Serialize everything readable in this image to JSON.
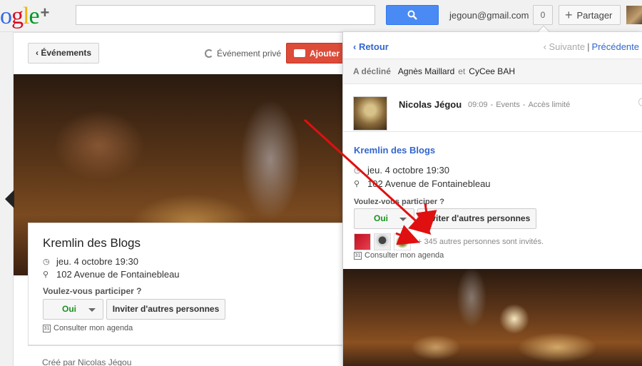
{
  "topbar": {
    "logo_parts": [
      "o",
      "g",
      "l",
      "e"
    ],
    "logo_plus": "+",
    "user_email": "jegoun@gmail.com",
    "notifications_count": "0",
    "share_label": "Partager"
  },
  "left": {
    "back_label": "Événements",
    "private_label": "Événement privé",
    "add_photo_label": "Ajouter",
    "title": "Kremlin des Blogs",
    "date": "jeu. 4 octobre 19:30",
    "address": "102 Avenue de Fontainebleau",
    "ask": "Voulez-vous participer ?",
    "rsvp": "Oui",
    "invite_label": "Inviter d'autres personnes",
    "agenda_label": "Consulter mon agenda",
    "created_by": "Créé par Nicolas Jégou"
  },
  "panel": {
    "back_label": "‹ Retour",
    "next_label": "‹ Suivante",
    "prev_label": "Précédente",
    "declined_label": "A décliné",
    "declined_name_1": "Agnès Maillard",
    "declined_and": "et",
    "declined_name_2": "CyCee BAH",
    "author": "Nicolas Jégou",
    "time": "09:09",
    "source": "Events",
    "visibility": "Accès limité",
    "event_title": "Kremlin des Blogs",
    "date": "jeu. 4 octobre 19:30",
    "address": "102 Avenue de Fontainebleau",
    "ask": "Voulez-vous participer ?",
    "rsvp": "Oui",
    "invite_label": "Inviter d'autres personnes",
    "more_invited": "+ 345 autres personnes sont invités.",
    "agenda_label": "Consulter mon agenda"
  },
  "colors": {
    "link_blue": "#3366cc",
    "search_blue": "#4a8af4",
    "add_red": "#dd4b39",
    "rsvp_green": "#1a9120",
    "annotation_red": "#e01010"
  }
}
